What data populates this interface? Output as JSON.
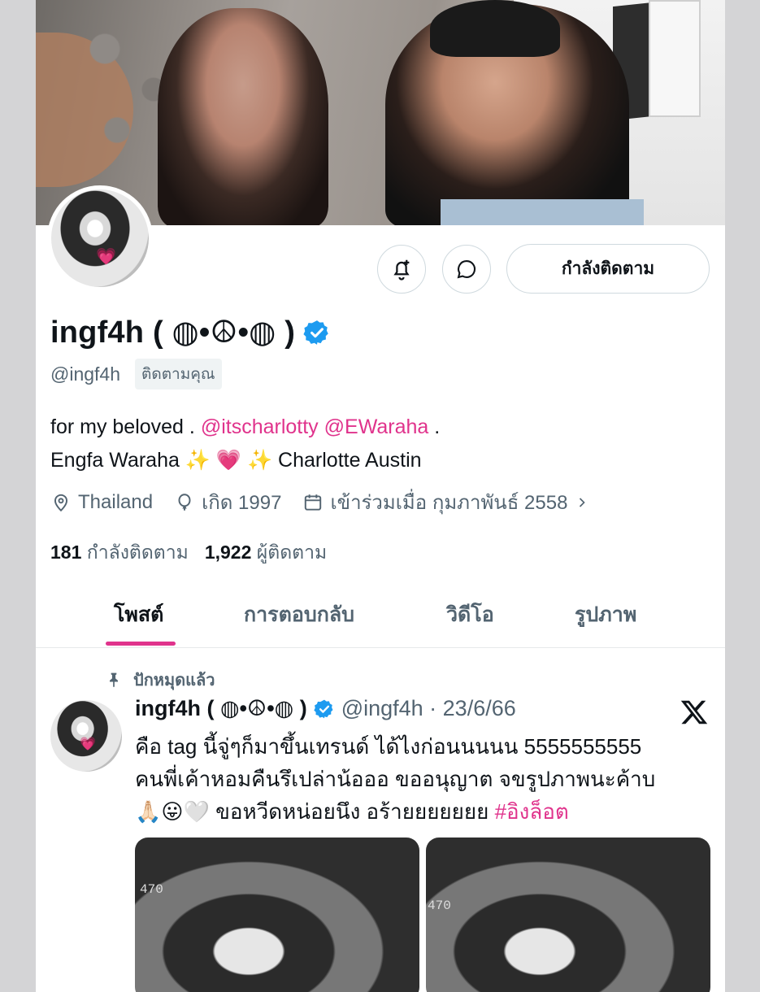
{
  "profile": {
    "name": "ingf4h ( ◍•☮•◍ )",
    "handle": "@ingf4h",
    "follows_you": "ติดตามคุณ",
    "follow_button": "กำลังติดตาม",
    "bio_line1_prefix": "for my beloved . ",
    "mention1": "@itscharlotty",
    "mention2": "@EWaraha",
    "bio_line1_suffix": " .",
    "bio_line2": "Engfa Waraha ✨ 💗 ✨ Charlotte Austin",
    "location": "Thailand",
    "birth": "เกิด 1997",
    "joined": "เข้าร่วมเมื่อ กุมภาพันธ์ 2558",
    "following_count": "181",
    "following_label": "กำลังติดตาม",
    "followers_count": "1,922",
    "followers_label": "ผู้ติดตาม"
  },
  "tabs": [
    {
      "label": "โพสต์",
      "active": true
    },
    {
      "label": "การตอบกลับ",
      "active": false
    },
    {
      "label": "วิดีโอ",
      "active": false
    },
    {
      "label": "รูปภาพ",
      "active": false
    }
  ],
  "post": {
    "pinned_label": "ปักหมุดแล้ว",
    "name": "ingf4h ( ◍•☮•◍ )",
    "handle_date": "@ingf4h · 23/6/66",
    "line1": "คือ tag นี้จู่ๆก็มาขึ้นเทรนด์ ได้ไงก่อนนนนน 5555555555",
    "line2": "คนพี่เค้าหอมคืนรึเปล่าน้อออ ขออนุญาต จขรูปภาพนะค้าบ",
    "line3_prefix": "🙏🏻😛🤍 ขอหวีดหน่อยนึง อร้ายยยยยยย ",
    "hashtag": "#อิงล็อต",
    "media_hud": "470"
  },
  "colors": {
    "accent": "#e0338c",
    "verified": "#1d9bf0",
    "secondary_text": "#536471"
  },
  "icons": [
    "bell-plus-icon",
    "message-icon",
    "verified-icon",
    "location-icon",
    "birthday-icon",
    "calendar-icon",
    "chevron-right-icon",
    "pin-icon",
    "x-logo-icon"
  ]
}
